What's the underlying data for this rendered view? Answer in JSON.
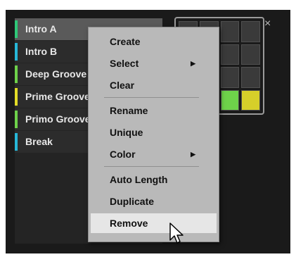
{
  "sections": [
    {
      "label": "Intro A",
      "color": "#2ec878",
      "selected": true
    },
    {
      "label": "Intro B",
      "color": "#27b7d8"
    },
    {
      "label": "Deep Groove",
      "color": "#6ed24a"
    },
    {
      "label": "Prime Groove",
      "color": "#e3dc27"
    },
    {
      "label": "Primo Groove",
      "color": "#6ed24a"
    },
    {
      "label": "Break",
      "color": "#27b7d8"
    }
  ],
  "close_glyph": "×",
  "menu": {
    "create": "Create",
    "select": "Select",
    "clear": "Clear",
    "rename": "Rename",
    "unique": "Unique",
    "color": "Color",
    "auto_length": "Auto Length",
    "duplicate": "Duplicate",
    "remove": "Remove",
    "submenu_arrow": "▶"
  },
  "pattern_grid": {
    "cells": [
      "#3a3a3a",
      "#3a3a3a",
      "#3a3a3a",
      "#3a3a3a",
      "#3a3a3a",
      "#3a3a3a",
      "#3a3a3a",
      "#3a3a3a",
      "#3a3a3a",
      "#3a3a3a",
      "#3a3a3a",
      "#3a3a3a",
      "#3a3a3a",
      "#3a3a3a",
      "#6ed24a",
      "#d6cf2a"
    ]
  }
}
